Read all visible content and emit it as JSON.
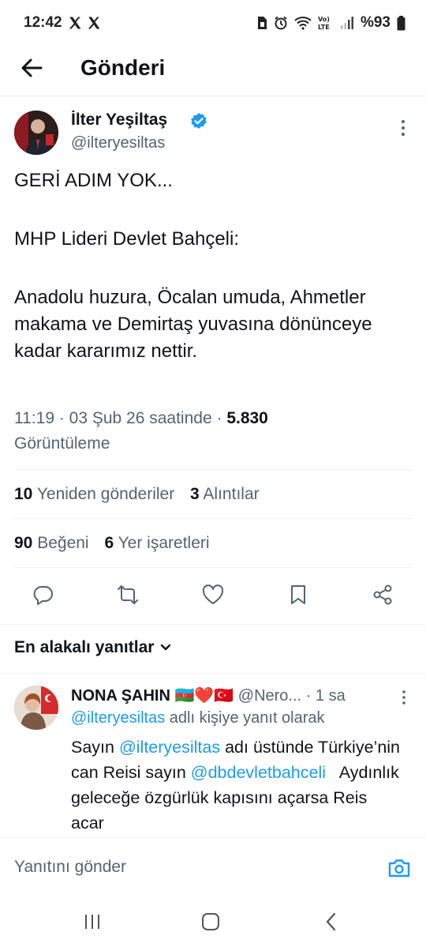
{
  "status_bar": {
    "time": "12:42",
    "battery": "%93",
    "icons": [
      "x-logo-icon",
      "x-logo-icon",
      "sim-icon",
      "alarm-icon",
      "wifi-icon",
      "volte-icon",
      "signal-icon",
      "battery-icon"
    ]
  },
  "header": {
    "title": "Gönderi",
    "back_icon": "arrow-left-icon"
  },
  "author": {
    "name": "İlter Yeşiltaş",
    "handle": "@ilteryesiltas",
    "verified": true
  },
  "tweet": {
    "line1": "GERİ ADIM YOK...",
    "line2": "MHP Lideri Devlet Bahçeli:",
    "line3": "Anadolu huzura, Öcalan umuda, Ahmetler makama ve Demirtaş yuvasına dönünceye kadar kararımız nettir."
  },
  "meta": {
    "time": "11:19 · 03 Şub 26 saatinde · ",
    "views": "5.830",
    "views_label": "Görüntüleme"
  },
  "stats": {
    "retweets": "10",
    "retweets_label": "Yeniden gönderiler",
    "quotes": "3",
    "quotes_label": "Alıntılar",
    "likes": "90",
    "likes_label": "Beğeni",
    "bookmarks": "6",
    "bookmarks_label": "Yer işaretleri"
  },
  "actions": [
    "reply-icon",
    "retweet-icon",
    "like-icon",
    "bookmark-icon",
    "share-icon"
  ],
  "replies_filter": "En alakalı yanıtlar",
  "reply": {
    "name": "NONA ŞAHIN",
    "flags": "🇦🇿❤️🇹🇷",
    "handle": "@Nero...",
    "time": " · 1 sa",
    "reply_to_handle": "@ilteryesiltas",
    "reply_to_suffix": " adlı kişiye yanıt olarak",
    "text_a": "Sayın ",
    "mention1": "@ilteryesiltas",
    "text_b": " adı üstünde Türkiye’nin can Reisi sayın ",
    "mention2": "@dbdevletbahceli",
    "text_c": "   Aydınlık geleceğe özgürlük kapısını açarsa Reis acar"
  },
  "composer": {
    "placeholder": "Yanıtını gönder"
  },
  "colors": {
    "accent": "#1d9bf0",
    "text": "#0f1419",
    "secondary": "#536471"
  }
}
